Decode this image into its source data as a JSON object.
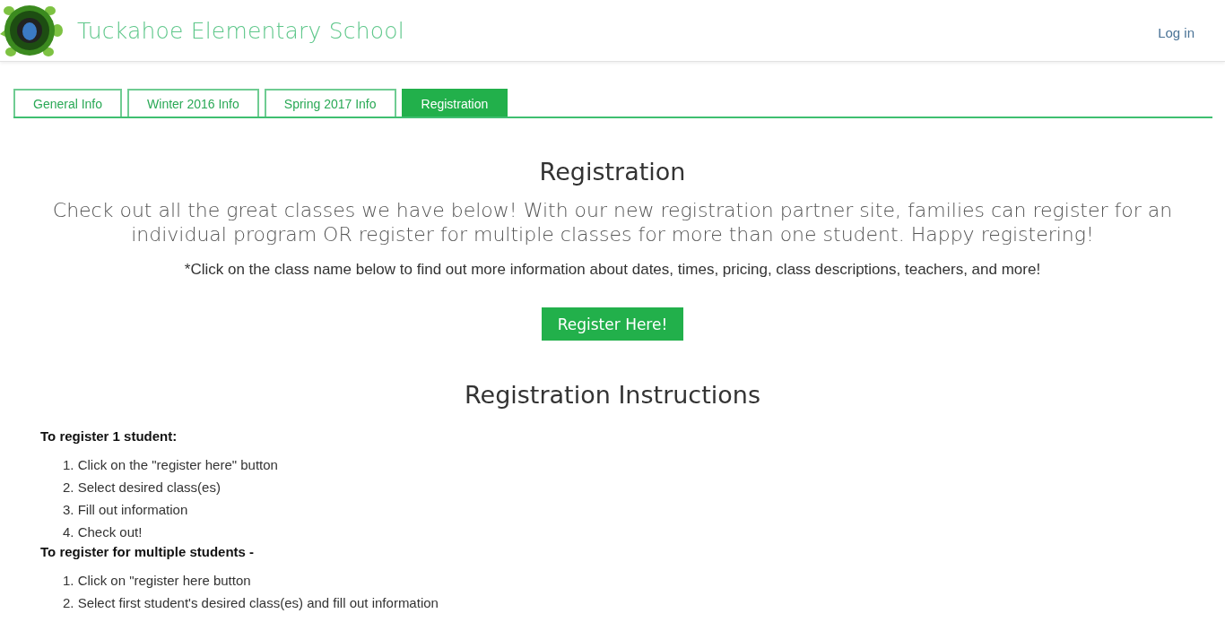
{
  "header": {
    "site_title": "Tuckahoe Elementary School",
    "login": "Log in"
  },
  "tabs": [
    {
      "label": "General Info",
      "selected": false
    },
    {
      "label": "Winter 2016 Info",
      "selected": false
    },
    {
      "label": "Spring 2017 Info",
      "selected": false
    },
    {
      "label": "Registration",
      "selected": true
    }
  ],
  "content": {
    "heading": "Registration",
    "intro": "Check out all the great classes we have below! With our new registration partner site, families can register for an individual program OR register for multiple classes for more than one student. Happy registering!",
    "note": "*Click on the class name below to find out more information about dates, times, pricing, class descriptions, teachers, and more!",
    "button": "Register Here!",
    "instructions_heading": "Registration Instructions",
    "sections": [
      {
        "title": "To register 1 student:",
        "steps": [
          {
            "number": "1.",
            "text": "Click on the \"register here\" button"
          },
          {
            "number": "2.",
            "text": "Select desired class(es)"
          },
          {
            "number": "3.",
            "text": "Fill out information"
          },
          {
            "number": "4.",
            "text": "Check out!"
          }
        ]
      },
      {
        "title": "To register for multiple students -",
        "steps": [
          {
            "number": "1.",
            "text": "Click on \"register here button"
          },
          {
            "number": "2.",
            "text": "Select first student's desired class(es) and fill out information"
          }
        ]
      }
    ]
  }
}
